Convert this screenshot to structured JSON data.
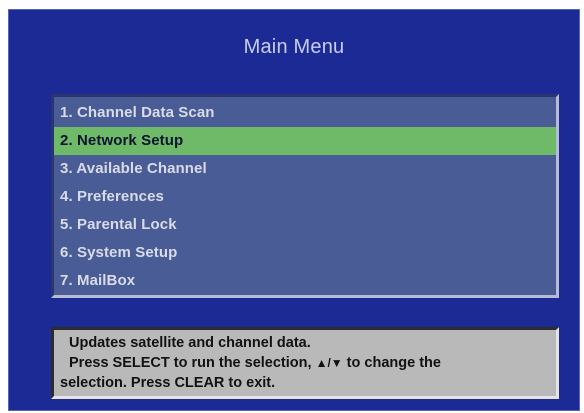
{
  "menu": {
    "title": "Main Menu",
    "items": [
      {
        "label": "1. Channel Data Scan",
        "selected": false
      },
      {
        "label": "2. Network Setup",
        "selected": true
      },
      {
        "label": "3. Available Channel",
        "selected": false
      },
      {
        "label": "4. Preferences",
        "selected": false
      },
      {
        "label": "5. Parental Lock",
        "selected": false
      },
      {
        "label": "6. System Setup",
        "selected": false
      },
      {
        "label": "7. MailBox",
        "selected": false
      }
    ]
  },
  "help": {
    "line1": "Updates satellite and channel data.",
    "line2_pre": "Press SELECT to run the selection, ",
    "arrows": "▲/▼",
    "line2_post": " to change the",
    "line3": "selection.  Press CLEAR to exit."
  },
  "colors": {
    "background": "#1c2a96",
    "menu_panel": "#4a5c96",
    "selected_highlight": "#6fba68",
    "help_panel": "#b9b9b9"
  }
}
